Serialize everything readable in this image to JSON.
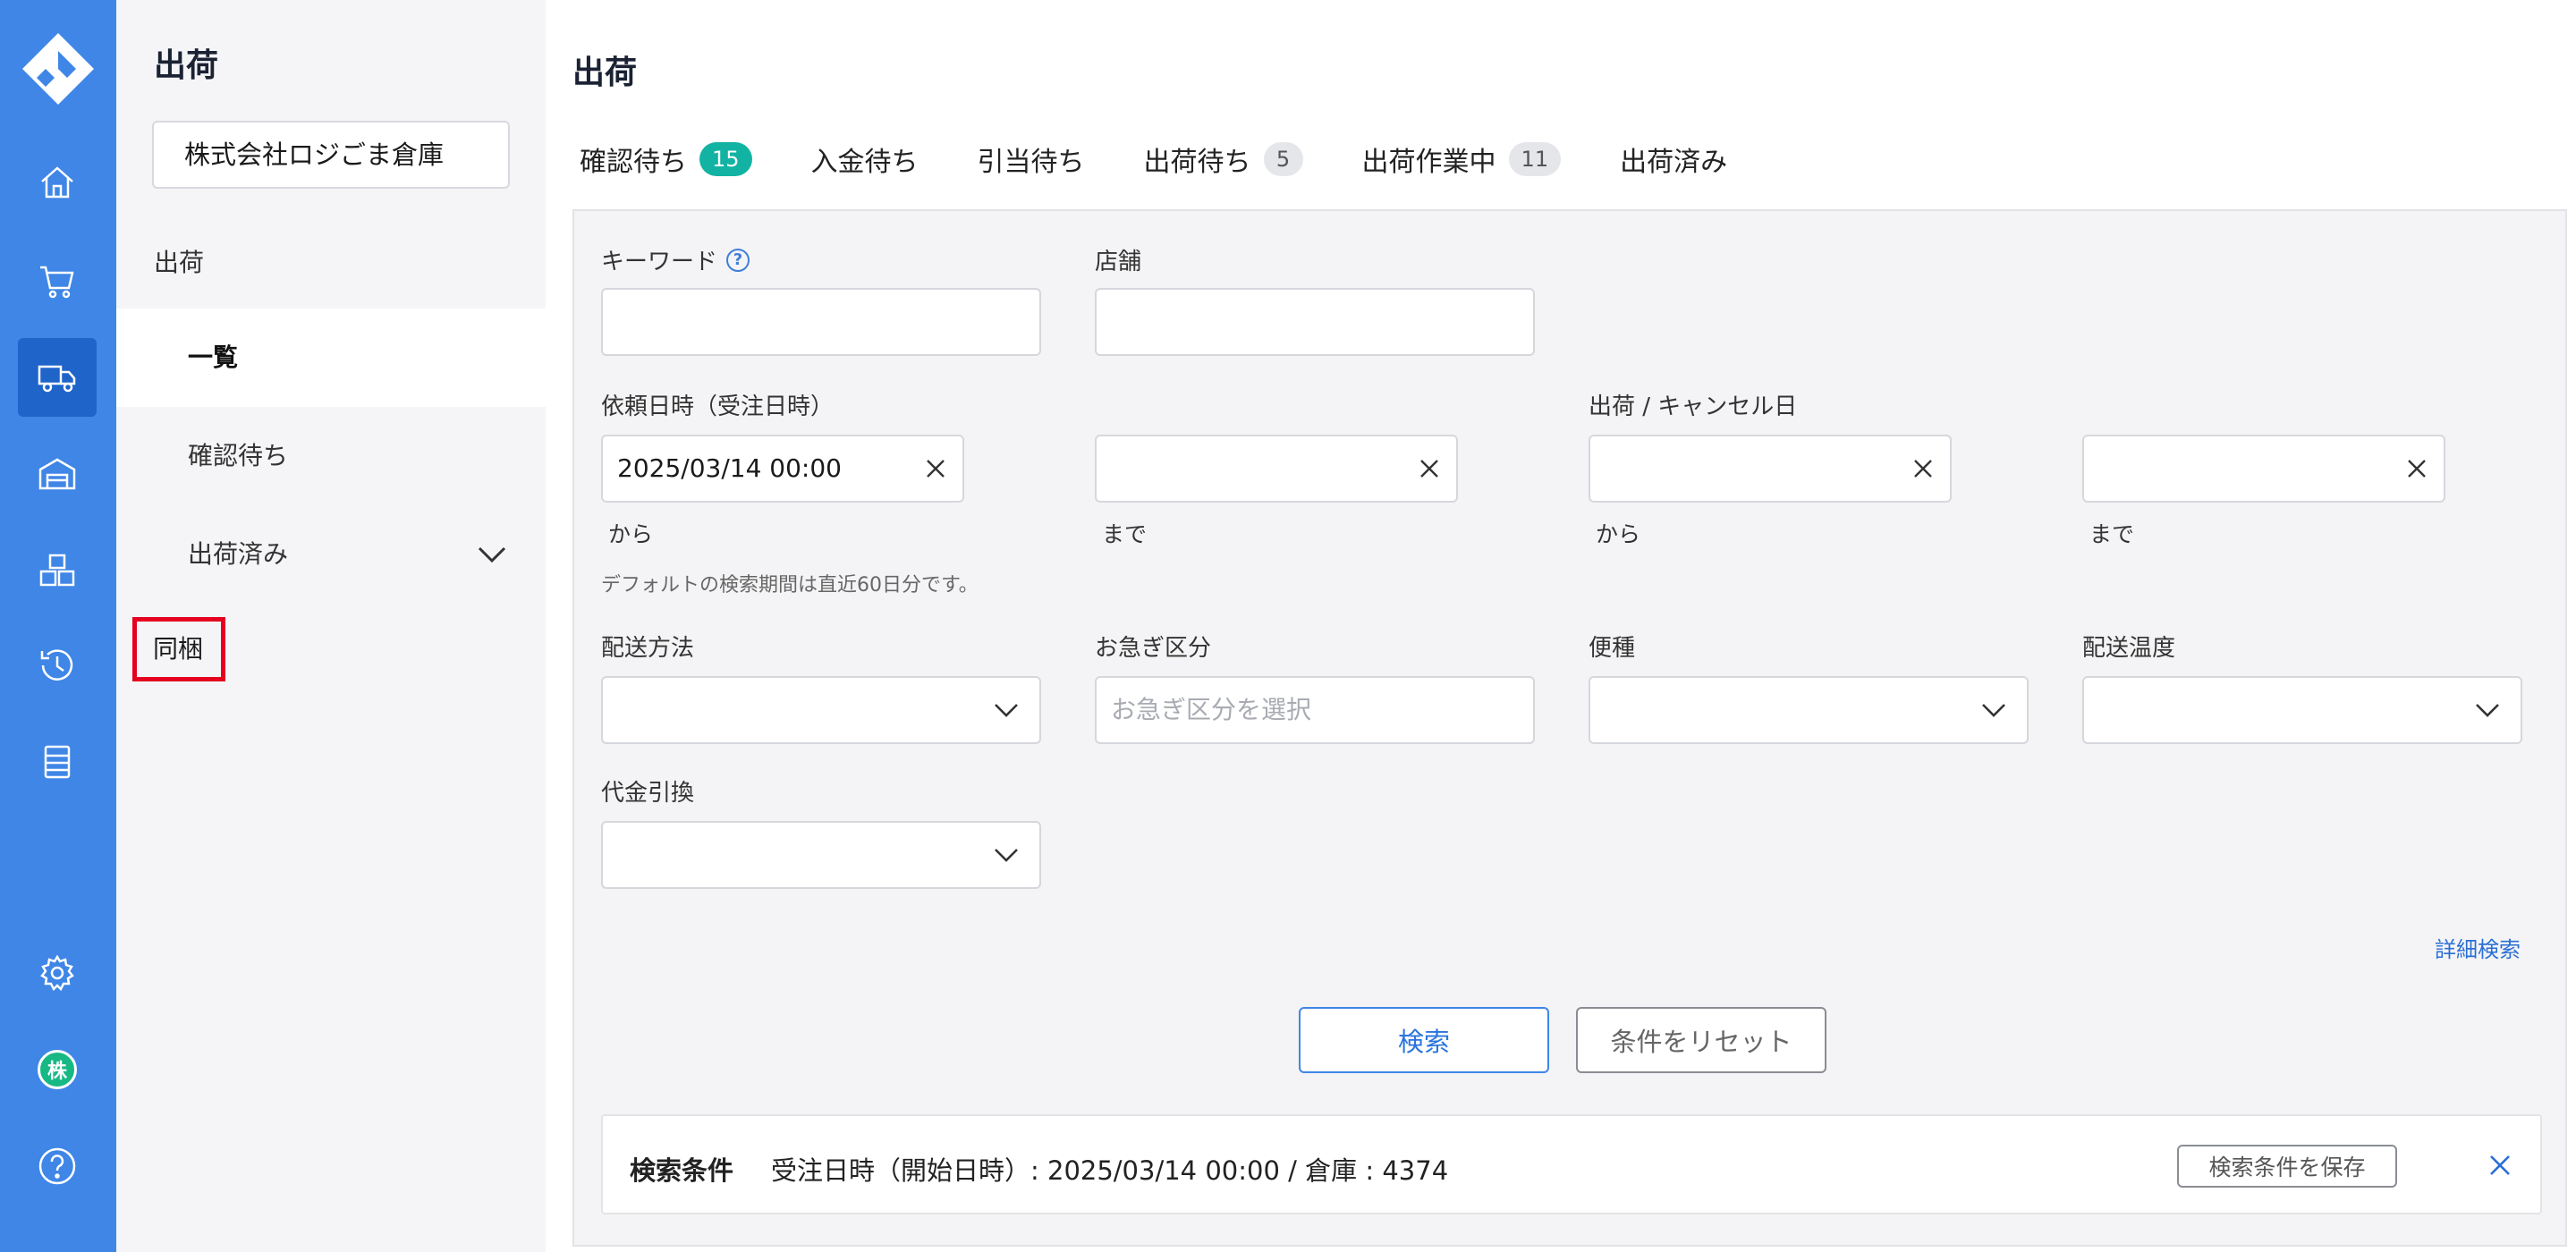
{
  "rail": {
    "items": [
      {
        "name": "home-icon"
      },
      {
        "name": "cart-icon"
      },
      {
        "name": "truck-icon",
        "active": true
      },
      {
        "name": "warehouse-icon"
      },
      {
        "name": "boxes-icon"
      },
      {
        "name": "history-icon"
      },
      {
        "name": "list-icon"
      }
    ],
    "avatar_label": "株"
  },
  "sidebar": {
    "title": "出荷",
    "org_select": "株式会社ロジごま倉庫",
    "section": "出荷",
    "items": [
      {
        "label": "一覧",
        "active": true
      },
      {
        "label": "確認待ち"
      },
      {
        "label": "出荷済み",
        "expandable": true
      }
    ],
    "bundle": "同梱"
  },
  "main": {
    "title": "出荷",
    "tabs": [
      {
        "label": "確認待ち",
        "badge": "15",
        "badge_style": "green"
      },
      {
        "label": "入金待ち"
      },
      {
        "label": "引当待ち"
      },
      {
        "label": "出荷待ち",
        "badge": "5",
        "badge_style": "gray"
      },
      {
        "label": "出荷作業中",
        "badge": "11",
        "badge_style": "gray"
      },
      {
        "label": "出荷済み"
      }
    ]
  },
  "form": {
    "keyword_label": "キーワード",
    "store_label": "店舗",
    "request_date_label": "依頼日時（受注日時）",
    "request_from_value": "2025/03/14 00:00",
    "from_text": "から",
    "to_text": "まで",
    "ship_cancel_label": "出荷 / キャンセル日",
    "default_note": "デフォルトの検索期間は直近60日分です。",
    "delivery_method_label": "配送方法",
    "urgency_label": "お急ぎ区分",
    "urgency_placeholder": "お急ぎ区分を選択",
    "service_label": "便種",
    "temperature_label": "配送温度",
    "cod_label": "代金引換",
    "advanced_link": "詳細検索",
    "search_button": "検索",
    "reset_button": "条件をリセット"
  },
  "summary": {
    "title": "検索条件",
    "text": "受注日時（開始日時）: 2025/03/14 00:00 / 倉庫 : 4374",
    "save_button": "検索条件を保存"
  },
  "colors": {
    "rail": "#3f86e6",
    "rail_active": "#1f64c9",
    "badge_green": "#12b3a3",
    "highlight": "#e5001f",
    "link": "#2a6fd4"
  }
}
